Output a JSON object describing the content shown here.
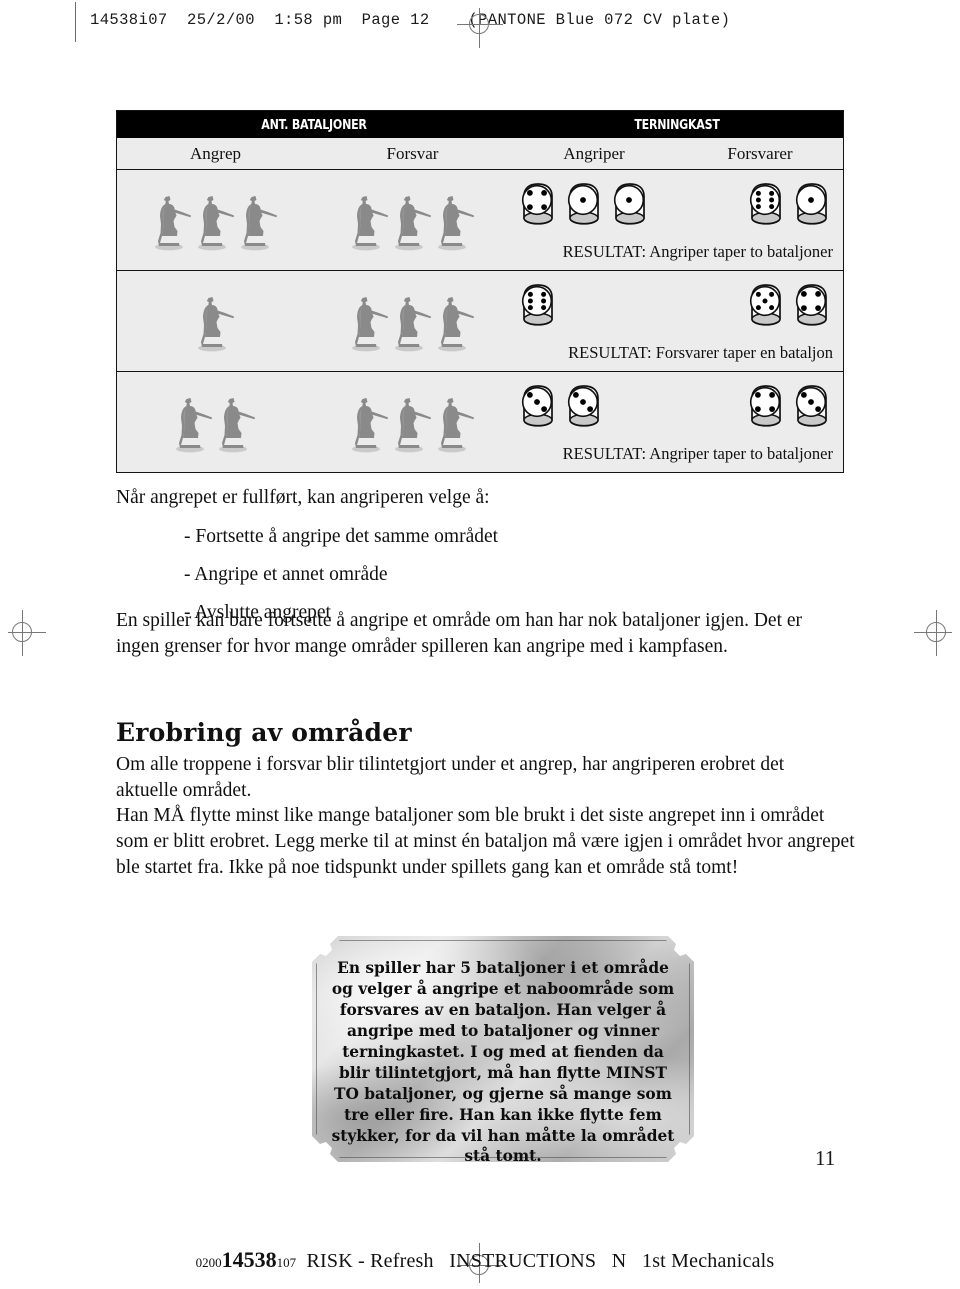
{
  "print_header": {
    "text": "14538i07  25/2/00  1:58 pm  Page 12    (PANTONE Blue 072 CV plate)"
  },
  "battle_table": {
    "banner": {
      "left_label": "ANT. BATALJONER",
      "right_label": "TERNINGKAST"
    },
    "subheaders": {
      "attack": "Angrep",
      "defense": "Forsvar",
      "attacker_dice": "Angriper",
      "defender_dice": "Forsvarer"
    },
    "rows": [
      {
        "attacker_troops": 3,
        "defender_troops": 3,
        "attacker_dice": [
          4,
          1,
          1
        ],
        "defender_dice": [
          6,
          1
        ],
        "result": "RESULTAT: Angriper taper to bataljoner"
      },
      {
        "attacker_troops": 1,
        "defender_troops": 3,
        "attacker_dice": [
          6
        ],
        "defender_dice": [
          5,
          4
        ],
        "result": "RESULTAT: Forsvarer taper en bataljon"
      },
      {
        "attacker_troops": 2,
        "defender_troops": 3,
        "attacker_dice": [
          3,
          3
        ],
        "defender_dice": [
          4,
          3
        ],
        "result": "RESULTAT: Angriper taper to bataljoner"
      }
    ]
  },
  "body": {
    "intro_line": "Når angrepet er fullført, kan angriperen velge å:",
    "choices": [
      "- Fortsette å angripe det samme området",
      "- Angripe et annet område",
      "- Avslutte angrepet"
    ],
    "para_limits": "En spiller kan bare fortsette å angripe et område om han har nok bataljoner igjen. Det er ingen grenser for hvor mange områder spilleren kan angripe med i kampfasen.",
    "heading_conquest": "Erobring av områder",
    "para_conquest_1": "Om alle troppene i forsvar blir tilintetgjort under et angrep, har angriperen erobret det aktuelle området.",
    "para_conquest_2": "Han MÅ flytte minst like mange bataljoner som ble brukt i det siste angrepet inn i området som er blitt erobret. Legg merke til at minst én bataljon må være igjen i området hvor angrepet ble startet fra. Ikke på noe tidspunkt under spillets gang kan et område stå tomt!"
  },
  "callout": {
    "text": "En spiller har 5 bataljoner i et område og velger å angripe et naboområde som forsvares av en bataljon. Han velger å angripe med to bataljoner og vinner terningkastet. I og med at fienden da blir tilintetgjort, må han flytte MINST TO bataljoner, og gjerne så mange som tre eller fire. Han kan ikke flytte fem stykker, for da vil han måtte la området stå tomt."
  },
  "page_number": "11",
  "colophon": {
    "prefix": "0200",
    "job": "14538",
    "suffix": "107",
    "rest": "  RISK - Refresh   INSTRUCTIONS   N   1st Mechanicals"
  },
  "colors": {
    "table_fill": "#ececec",
    "banner": "#000000",
    "rule": "#141414",
    "soldier_gray": "#8a8a8a",
    "mark_gray": "#777777"
  }
}
